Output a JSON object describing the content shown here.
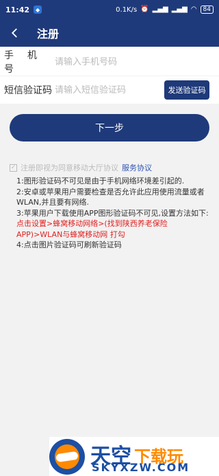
{
  "statusbar": {
    "time": "11:42",
    "net_speed": "0.1K/s",
    "battery": "84"
  },
  "appbar": {
    "title": "注册"
  },
  "form": {
    "phone_label": "手机号",
    "phone_placeholder": "请输入手机号码",
    "sms_label": "短信验证码",
    "sms_placeholder": "请输入短信验证码",
    "send_code": "发送验证码"
  },
  "next_button": "下一步",
  "agreement": {
    "text": "注册即视为同意移动大厅协议",
    "link": "服务协议"
  },
  "notes": {
    "l1": "1:图形验证码不可见是由于手机网络环境差引起的.",
    "l2": "2:安卓或苹果用户需要检查是否允许此应用使用流量或者WLAN,并且要有网络.",
    "l3": "3:苹果用户下载使用APP图形验证码不可见,设置方法如下:",
    "red": "点击设置>蜂窝移动网络>(找到陕西养老保险APP)>WLAN与蜂窝移动网 打勾",
    "l4": "4:点击图片验证码可刷新验证码"
  },
  "watermark": {
    "cn1": "天空",
    "cn2": "下载玩",
    "domain": "SKYXZW.COM"
  }
}
